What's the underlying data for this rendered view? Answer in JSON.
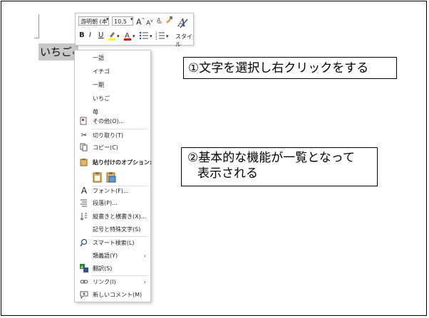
{
  "document": {
    "selected_text": "いちご",
    "paragraph_mark": "↵"
  },
  "mini_toolbar": {
    "font_name": "游明朝 (本",
    "font_size": "10.5",
    "grow_font": "A",
    "shrink_font": "A",
    "bold": "B",
    "italic": "I",
    "underline": "U",
    "font_color_letter": "A",
    "styles_label": "スタイル"
  },
  "context_menu": {
    "suggestions": [
      "一語",
      "イチゴ",
      "一期",
      "いちご",
      "苺"
    ],
    "other": "その他(O)...",
    "cut": "切り取り(T)",
    "copy": "コピー(C)",
    "paste_options": "貼り付けのオプション:",
    "font": "フォント(F)...",
    "paragraph": "段落(P)...",
    "text_direction": "縦書きと横書き(X)...",
    "symbols": "記号と特殊文字(S)",
    "smart_lookup": "スマート検索(L)",
    "synonyms": "類義語(Y)",
    "translate": "翻訳(S)",
    "link": "リンク(I)",
    "new_comment": "新しいコメント(M)",
    "submenu_arrow": "›"
  },
  "callouts": {
    "step1": "①文字を選択し右クリックをする",
    "step2_line1": "②基本的な機能が一覧となって",
    "step2_line2": "表示される"
  },
  "colors": {
    "selection": "#c8c8c8",
    "highlight_yellow": "#ffff00",
    "font_red": "#e00000",
    "icon_blue": "#2b5797"
  }
}
